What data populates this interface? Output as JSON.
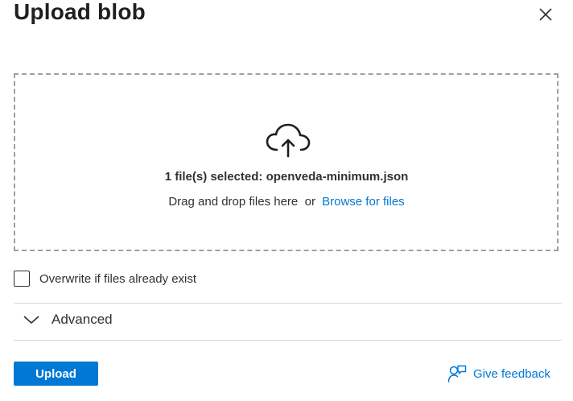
{
  "panel": {
    "title": "Upload blob",
    "close_icon": "close-icon"
  },
  "dropzone": {
    "icon": "cloud-upload-icon",
    "selected_text": "1 file(s) selected: openveda-minimum.json",
    "drag_text": "Drag and drop files here",
    "or_text": "or",
    "browse_link": "Browse for files"
  },
  "options": {
    "overwrite_label": "Overwrite if files already exist",
    "overwrite_checked": false
  },
  "advanced": {
    "label": "Advanced",
    "icon": "chevron-down-icon",
    "expanded": false
  },
  "footer": {
    "upload_label": "Upload",
    "feedback_label": "Give feedback",
    "feedback_icon": "feedback-person-icon"
  },
  "colors": {
    "accent": "#0078d4",
    "text": "#323130",
    "border": "#a19f9d"
  }
}
